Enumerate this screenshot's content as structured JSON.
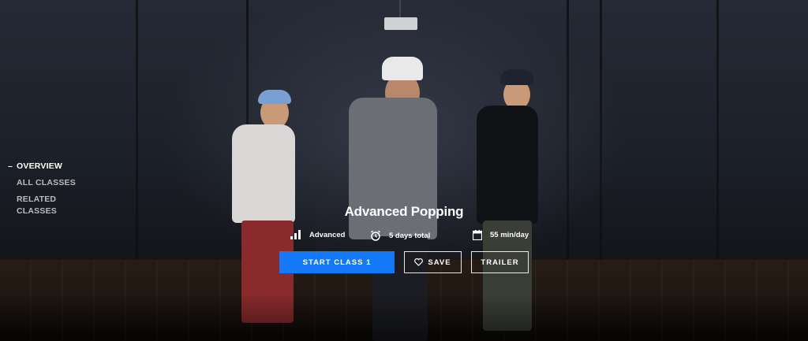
{
  "nav": {
    "items": [
      {
        "label": "OVERVIEW",
        "active": true
      },
      {
        "label": "ALL CLASSES",
        "active": false
      },
      {
        "label": "RELATED CLASSES",
        "active": false
      }
    ]
  },
  "class": {
    "title": "Advanced Popping",
    "level": "Advanced",
    "duration": "5 days total",
    "daily_time": "55 min/day"
  },
  "icons": {
    "level": "signal-bars-icon",
    "duration": "alarm-clock-icon",
    "daily_time": "calendar-icon",
    "save": "heart-icon"
  },
  "actions": {
    "start_label": "START CLASS 1",
    "save_label": "SAVE",
    "trailer_label": "TRAILER"
  },
  "colors": {
    "primary": "#1479f6",
    "text": "#ffffff",
    "nav_inactive": "#b9bbbf"
  }
}
